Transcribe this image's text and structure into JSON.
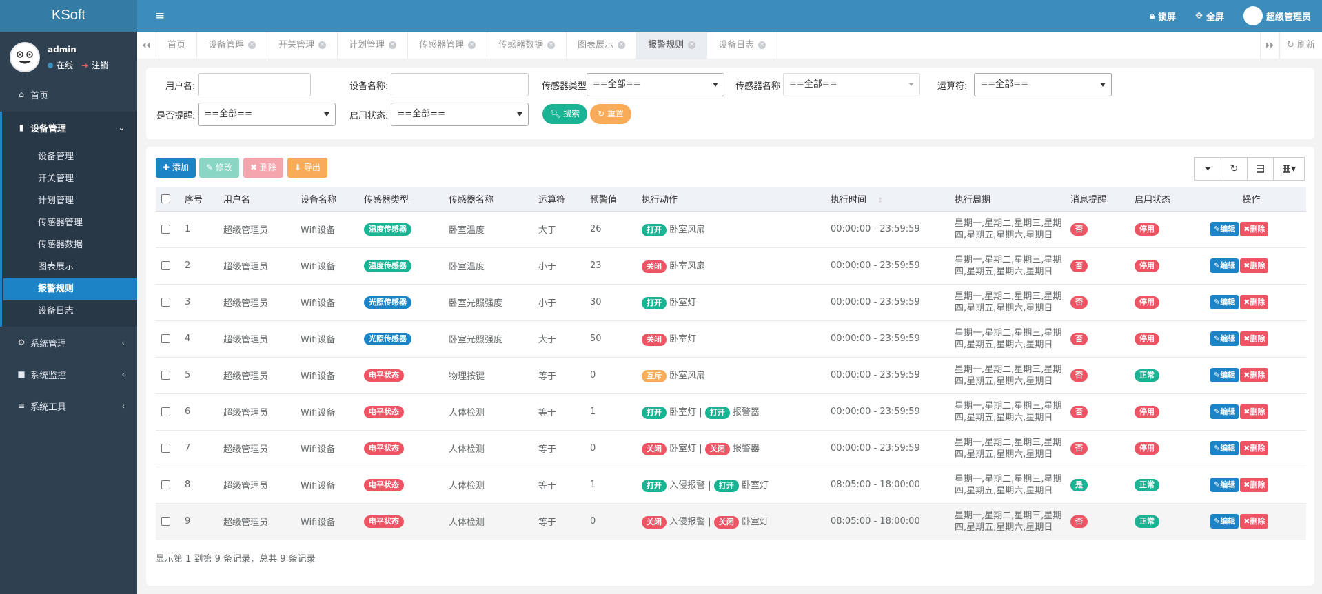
{
  "app": {
    "title": "KSoft"
  },
  "user": {
    "name": "admin",
    "status": "在线",
    "logout": "注销"
  },
  "sidebar": {
    "home": "首页",
    "device_mgmt": "设备管理",
    "sub_items": [
      "设备管理",
      "开关管理",
      "计划管理",
      "传感器管理",
      "传感器数据",
      "图表展示",
      "报警规则",
      "设备日志"
    ],
    "active_index": 6,
    "sys_mgmt": "系统管理",
    "sys_monitor": "系统监控",
    "sys_tools": "系统工具"
  },
  "topbar": {
    "lock": "锁屏",
    "fullscreen": "全屏",
    "admin": "超级管理员"
  },
  "tabs": {
    "items": [
      "首页",
      "设备管理",
      "开关管理",
      "计划管理",
      "传感器管理",
      "传感器数据",
      "图表展示",
      "报警规则",
      "设备日志"
    ],
    "active_index": 7,
    "refresh": "刷新"
  },
  "filters": {
    "username_label": "用户名:",
    "device_label": "设备名称:",
    "sensor_type_label": "传感器类型",
    "sensor_type_value": "==全部==",
    "sensor_name_label": "传感器名称",
    "sensor_name_value": "==全部==",
    "operator_label": "运算符:",
    "operator_value": "==全部==",
    "remind_label": "是否提醒:",
    "remind_value": "==全部==",
    "enable_label": "启用状态:",
    "enable_value": "==全部==",
    "search": "搜索",
    "reset": "重置"
  },
  "toolbar": {
    "add": "添加",
    "edit": "修改",
    "delete": "删除",
    "export": "导出"
  },
  "table": {
    "headers": [
      "序号",
      "用户名",
      "设备名称",
      "传感器类型",
      "传感器名称",
      "运算符",
      "预警值",
      "执行动作",
      "执行时间",
      "执行周期",
      "消息提醒",
      "启用状态",
      "操作"
    ],
    "edit_label": "编辑",
    "delete_label": "删除",
    "rows": [
      {
        "no": "1",
        "user": "超级管理员",
        "device": "Wifi设备",
        "stype": "温度传感器",
        "stype_color": "#1ab394",
        "sname": "卧室温度",
        "op": "大于",
        "value": "26",
        "actions": [
          {
            "badge": "打开",
            "color": "#1ab394",
            "text": "卧室风扇"
          }
        ],
        "time": "00:00:00 - 23:59:59",
        "period": "星期一,星期二,星期三,星期四,星期五,星期六,星期日",
        "remind": "否",
        "remind_color": "#ed5565",
        "status": "停用",
        "status_color": "#ed5565"
      },
      {
        "no": "2",
        "user": "超级管理员",
        "device": "Wifi设备",
        "stype": "温度传感器",
        "stype_color": "#1ab394",
        "sname": "卧室温度",
        "op": "小于",
        "value": "23",
        "actions": [
          {
            "badge": "关闭",
            "color": "#ed5565",
            "text": "卧室风扇"
          }
        ],
        "time": "00:00:00 - 23:59:59",
        "period": "星期一,星期二,星期三,星期四,星期五,星期六,星期日",
        "remind": "否",
        "remind_color": "#ed5565",
        "status": "停用",
        "status_color": "#ed5565"
      },
      {
        "no": "3",
        "user": "超级管理员",
        "device": "Wifi设备",
        "stype": "光照传感器",
        "stype_color": "#1c84c6",
        "sname": "卧室光照强度",
        "op": "小于",
        "value": "30",
        "actions": [
          {
            "badge": "打开",
            "color": "#1ab394",
            "text": "卧室灯"
          }
        ],
        "time": "00:00:00 - 23:59:59",
        "period": "星期一,星期二,星期三,星期四,星期五,星期六,星期日",
        "remind": "否",
        "remind_color": "#ed5565",
        "status": "停用",
        "status_color": "#ed5565"
      },
      {
        "no": "4",
        "user": "超级管理员",
        "device": "Wifi设备",
        "stype": "光照传感器",
        "stype_color": "#1c84c6",
        "sname": "卧室光照强度",
        "op": "大于",
        "value": "50",
        "actions": [
          {
            "badge": "关闭",
            "color": "#ed5565",
            "text": "卧室灯"
          }
        ],
        "time": "00:00:00 - 23:59:59",
        "period": "星期一,星期二,星期三,星期四,星期五,星期六,星期日",
        "remind": "否",
        "remind_color": "#ed5565",
        "status": "停用",
        "status_color": "#ed5565"
      },
      {
        "no": "5",
        "user": "超级管理员",
        "device": "Wifi设备",
        "stype": "电平状态",
        "stype_color": "#ed5565",
        "sname": "物理按键",
        "op": "等于",
        "value": "0",
        "actions": [
          {
            "badge": "互斥",
            "color": "#f8ac59",
            "text": "卧室风扇"
          }
        ],
        "time": "00:00:00 - 23:59:59",
        "period": "星期一,星期二,星期三,星期四,星期五,星期六,星期日",
        "remind": "否",
        "remind_color": "#ed5565",
        "status": "正常",
        "status_color": "#1ab394"
      },
      {
        "no": "6",
        "user": "超级管理员",
        "device": "Wifi设备",
        "stype": "电平状态",
        "stype_color": "#ed5565",
        "sname": "人体检测",
        "op": "等于",
        "value": "1",
        "actions": [
          {
            "badge": "打开",
            "color": "#1ab394",
            "text": "卧室灯"
          },
          {
            "badge": "打开",
            "color": "#1ab394",
            "text": "报警器"
          }
        ],
        "time": "00:00:00 - 23:59:59",
        "period": "星期一,星期二,星期三,星期四,星期五,星期六,星期日",
        "remind": "否",
        "remind_color": "#ed5565",
        "status": "停用",
        "status_color": "#ed5565"
      },
      {
        "no": "7",
        "user": "超级管理员",
        "device": "Wifi设备",
        "stype": "电平状态",
        "stype_color": "#ed5565",
        "sname": "人体检测",
        "op": "等于",
        "value": "0",
        "actions": [
          {
            "badge": "关闭",
            "color": "#ed5565",
            "text": "卧室灯"
          },
          {
            "badge": "关闭",
            "color": "#ed5565",
            "text": "报警器"
          }
        ],
        "time": "00:00:00 - 23:59:59",
        "period": "星期一,星期二,星期三,星期四,星期五,星期六,星期日",
        "remind": "否",
        "remind_color": "#ed5565",
        "status": "停用",
        "status_color": "#ed5565"
      },
      {
        "no": "8",
        "user": "超级管理员",
        "device": "Wifi设备",
        "stype": "电平状态",
        "stype_color": "#ed5565",
        "sname": "人体检测",
        "op": "等于",
        "value": "1",
        "actions": [
          {
            "badge": "打开",
            "color": "#1ab394",
            "text": "入侵报警"
          },
          {
            "badge": "打开",
            "color": "#1ab394",
            "text": "卧室灯"
          }
        ],
        "time": "08:05:00 - 18:00:00",
        "period": "星期一,星期二,星期三,星期四,星期五,星期六,星期日",
        "remind": "是",
        "remind_color": "#1ab394",
        "status": "正常",
        "status_color": "#1ab394"
      },
      {
        "no": "9",
        "user": "超级管理员",
        "device": "Wifi设备",
        "stype": "电平状态",
        "stype_color": "#ed5565",
        "sname": "人体检测",
        "op": "等于",
        "value": "0",
        "actions": [
          {
            "badge": "关闭",
            "color": "#ed5565",
            "text": "入侵报警"
          },
          {
            "badge": "关闭",
            "color": "#ed5565",
            "text": "卧室灯"
          }
        ],
        "time": "08:05:00 - 18:00:00",
        "period": "星期一,星期二,星期三,星期四,星期五,星期六,星期日",
        "remind": "否",
        "remind_color": "#ed5565",
        "status": "正常",
        "status_color": "#1ab394"
      }
    ]
  },
  "footer": {
    "summary": "显示第 1 到第 9 条记录，总共 9 条记录"
  }
}
